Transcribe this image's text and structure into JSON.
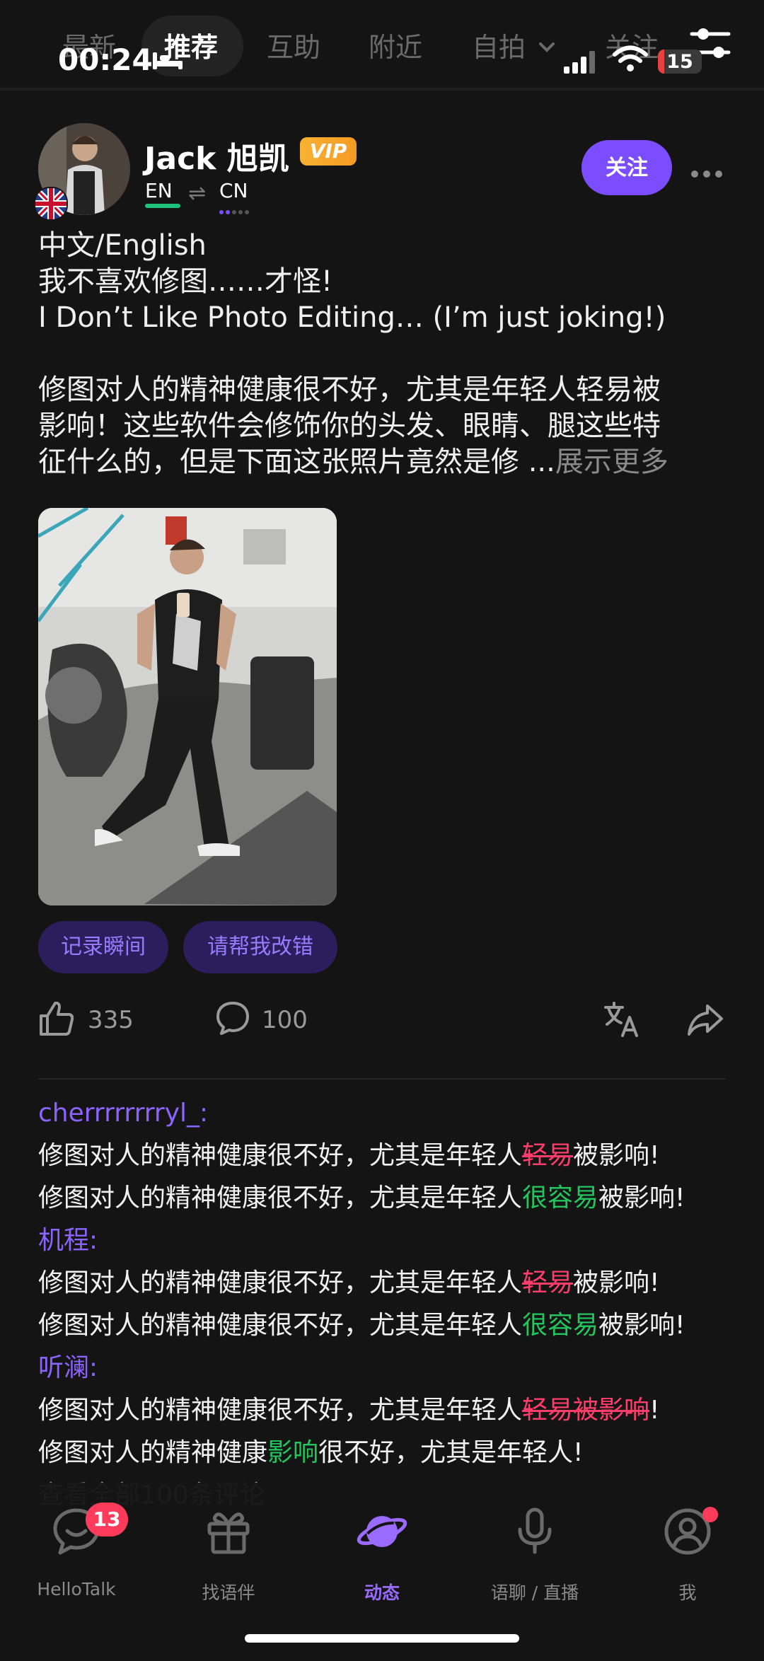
{
  "status_bar": {
    "time": "00:24",
    "battery": "15",
    "battery_level": 0.15
  },
  "top_tabs": [
    {
      "label": "最新"
    },
    {
      "label": "推荐",
      "active": true
    },
    {
      "label": "互助"
    },
    {
      "label": "附近"
    },
    {
      "label": "自拍"
    },
    {
      "label": "关注"
    }
  ],
  "post": {
    "author": "Jack 旭凯",
    "vip": "VIP",
    "native_language": "EN",
    "learning_language": "CN",
    "follow_label": "关注",
    "text_lines": [
      "中文/English",
      "我不喜欢修图……才怪!",
      "I Don’t Like Photo Editing… (I’m just joking!)",
      "",
      "修图对人的精神健康很不好，尤其是年轻人轻易被",
      "影响！这些软件会修饰你的头发、眼睛、腿这些特"
    ],
    "last_line": "征什么的，但是下面这张照片竟然是修 ...",
    "show_more": "展示更多",
    "tags": [
      "记录瞬间",
      "请帮我改错"
    ],
    "likes": "335",
    "comments_count": "100"
  },
  "comments": [
    {
      "user": "cherrrrrrrryl_:",
      "original": [
        "修图对人的精神健康很不好，尤其是年轻人",
        "轻易",
        "被影响!"
      ],
      "corrected": [
        "修图对人的精神健康很不好，尤其是年轻人",
        "很容易",
        "被影响!"
      ]
    },
    {
      "user": "机程:",
      "original": [
        "修图对人的精神健康很不好，尤其是年轻人",
        "轻易",
        "被影响!"
      ],
      "corrected": [
        "修图对人的精神健康很不好，尤其是年轻人",
        "很容易",
        "被影响!"
      ]
    },
    {
      "user": "听澜:",
      "original": [
        "修图对人的精神健康很不好，尤其是年轻人",
        "轻易被影响",
        "!"
      ],
      "corrected": [
        "修图对人的精神健康",
        "影响",
        "很不好，尤其是年轻人!"
      ]
    }
  ],
  "view_all_comments": "查看全部100条评论",
  "bottom_nav": [
    {
      "label": "HelloTalk",
      "icon": "chat-bubble-icon",
      "badge": "13"
    },
    {
      "label": "找语伴",
      "icon": "gift-icon"
    },
    {
      "label": "动态",
      "icon": "planet-icon",
      "active": true
    },
    {
      "label": "语聊 / 直播",
      "icon": "microphone-icon"
    },
    {
      "label": "我",
      "icon": "profile-icon",
      "dot": true
    }
  ],
  "colors": {
    "accent": "#7b4dff",
    "deleted_text": "#ff3d6b",
    "inserted_text": "#22c55e",
    "native_bar": "#1ec27a",
    "vip_gold": "#f5a623",
    "background": "#141414"
  }
}
